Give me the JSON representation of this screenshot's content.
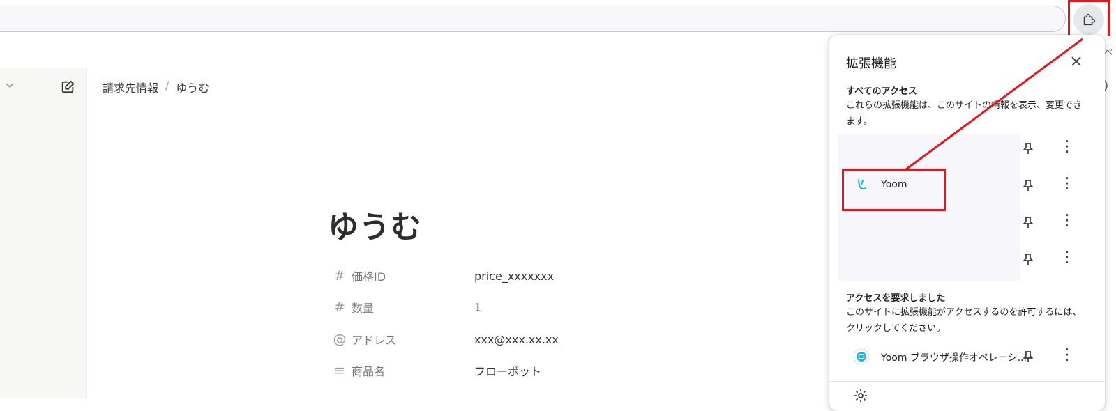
{
  "browser": {
    "bookmark_trunc": "ペ"
  },
  "app": {
    "breadcrumb": [
      "請求先情報",
      "/",
      "ゆうむ"
    ],
    "page_title": "ゆうむ",
    "properties": [
      {
        "icon": "#",
        "name": "価格ID",
        "value": "price_xxxxxxx"
      },
      {
        "icon": "#",
        "name": "数量",
        "value": "1"
      },
      {
        "icon": "@",
        "name": "アドレス",
        "value": "xxx@xxx.xx.xx"
      },
      {
        "icon": "≡",
        "name": "商品名",
        "value": "フローボット"
      }
    ]
  },
  "extensions_panel": {
    "title": "拡張機能",
    "all_access_title": "すべてのアクセス",
    "all_access_desc": "これらの拡張機能は、このサイトの情報を表示、変更できます。",
    "extension_yoom": "Yoom",
    "requested_title": "アクセスを要求しました",
    "requested_desc": "このサイトに拡張機能がアクセスするのを許可するには、クリックしてください。",
    "extension_yoom_browser": "Yoom ブラウザ操作オペレーシ...",
    "more_glyph": "⋮"
  },
  "colors": {
    "highlight": "#e8141b",
    "yoom_logo": "#1ab4e6"
  }
}
